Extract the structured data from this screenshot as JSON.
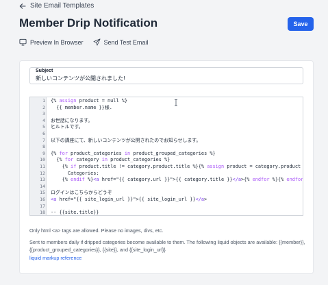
{
  "back_link": {
    "label": "Site Email Templates"
  },
  "page_title": "Member Drip Notification",
  "save_button": "Save",
  "actions": {
    "preview": "Preview In Browser",
    "send_test": "Send Test Email"
  },
  "subject": {
    "label": "Subject",
    "value": "新しいコンテンツが公開されました!"
  },
  "editor": {
    "lines": [
      "{% assign product = null %}",
      "  {{ member.name }}様.",
      "",
      "お世話になります。",
      "ヒルトルです。",
      "",
      "以下の講座にて、新しいコンテンツが公開されたのでお知らせします。",
      "",
      "{% for product_categories in product_grouped_categories %}",
      "  {% for category in product_categories %}",
      "    {% if product.title != category.product.title %}{% assign product = category.product %}{{ product.title }}",
      "      Categories:",
      "    {% endif %}<a href=\"{{ category.url }}\">{{ category.title }}</a>{% endfor %}{% endfor %}",
      "",
      "ログインはこちらからどうぞ",
      "<a href=\"{{ site_login_url }}\">{{ site_login_url }}</a>",
      "",
      "-- {{site.title}}",
      ""
    ]
  },
  "help": {
    "line1": "Only html <a> tags are allowed. Please no images, divs, etc.",
    "line2": "Sent to members daily if dripped categories become available to them. The following liquid objects are available: {{member}}, {{product_grouped_categories}}, {{site}}, and {{site_login_url}}",
    "link": "liquid markup reference"
  }
}
